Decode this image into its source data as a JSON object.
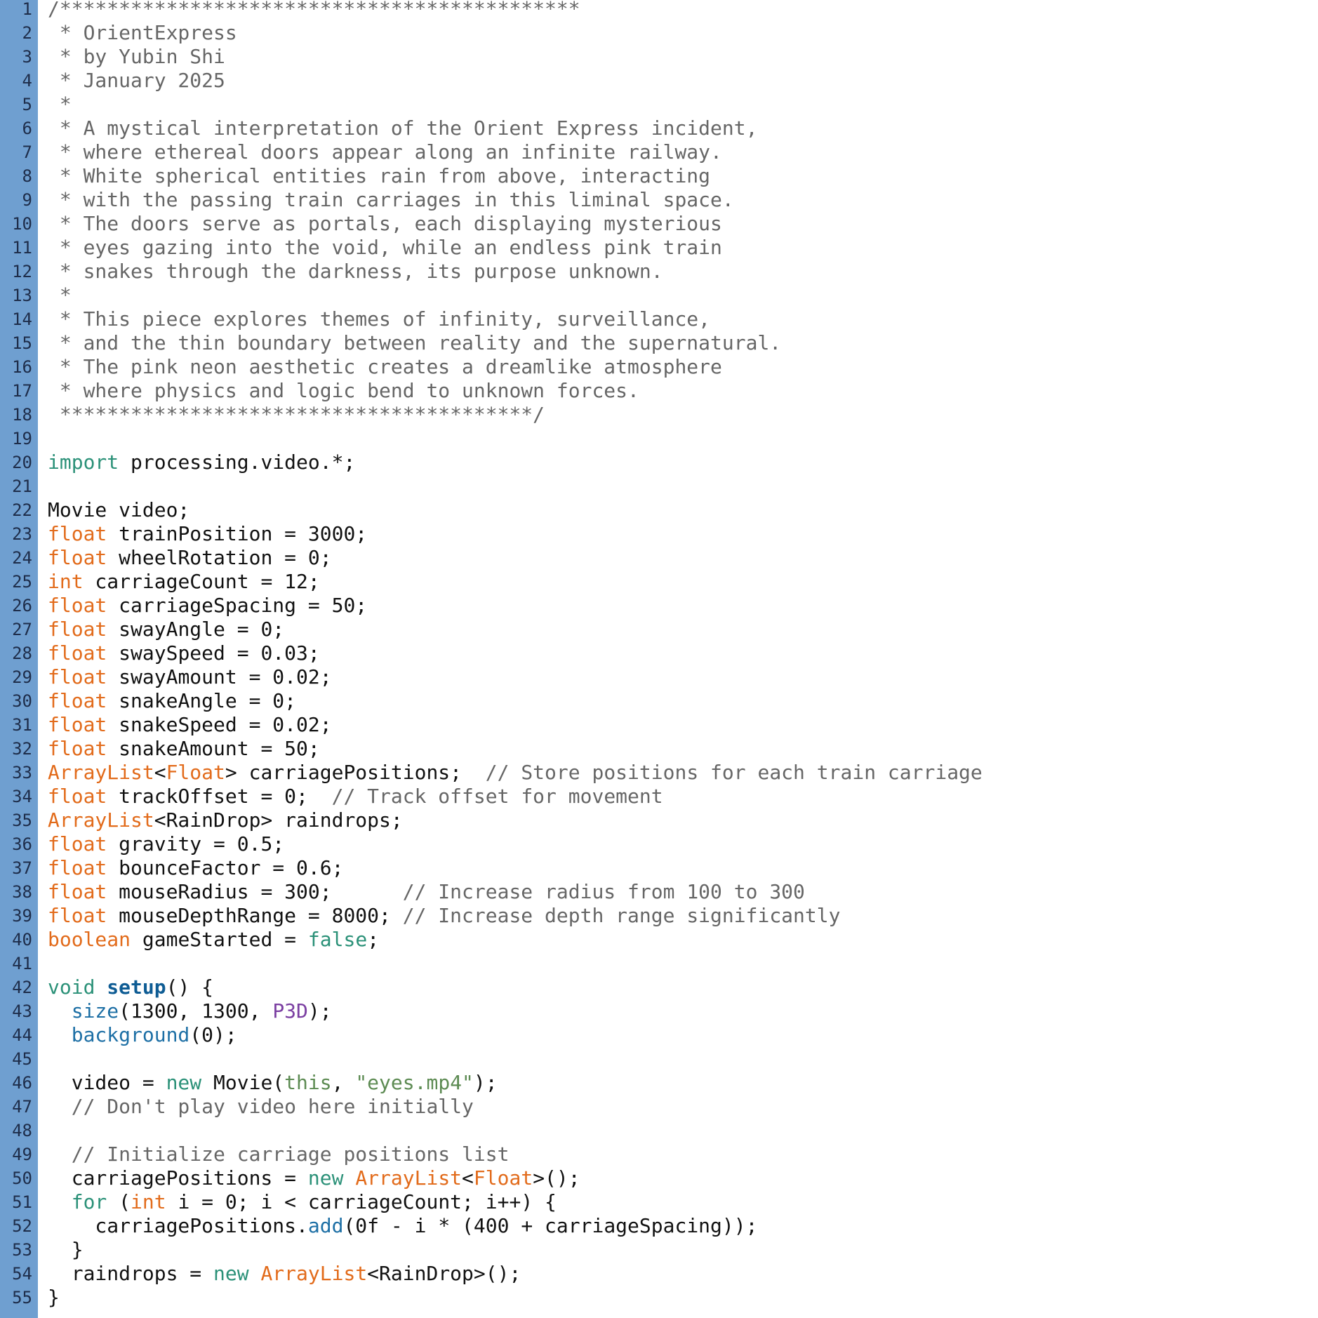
{
  "editor": {
    "colors": {
      "gutter": "#6f9fd0",
      "comment": "#666666",
      "keyword": "#2b9178",
      "type": "#e26b1b",
      "function": "#1d6fa5",
      "constant": "#7b3fa2",
      "string": "#5d8b53"
    },
    "lines": [
      {
        "n": "1",
        "tokens": [
          {
            "c": "comment",
            "t": "/********************************************"
          }
        ]
      },
      {
        "n": "2",
        "tokens": [
          {
            "c": "comment",
            "t": " * OrientExpress"
          }
        ]
      },
      {
        "n": "3",
        "tokens": [
          {
            "c": "comment",
            "t": " * by Yubin Shi"
          }
        ]
      },
      {
        "n": "4",
        "tokens": [
          {
            "c": "comment",
            "t": " * January 2025"
          }
        ]
      },
      {
        "n": "5",
        "tokens": [
          {
            "c": "comment",
            "t": " *"
          }
        ]
      },
      {
        "n": "6",
        "tokens": [
          {
            "c": "comment",
            "t": " * A mystical interpretation of the Orient Express incident,"
          }
        ]
      },
      {
        "n": "7",
        "tokens": [
          {
            "c": "comment",
            "t": " * where ethereal doors appear along an infinite railway."
          }
        ]
      },
      {
        "n": "8",
        "tokens": [
          {
            "c": "comment",
            "t": " * White spherical entities rain from above, interacting"
          }
        ]
      },
      {
        "n": "9",
        "tokens": [
          {
            "c": "comment",
            "t": " * with the passing train carriages in this liminal space."
          }
        ]
      },
      {
        "n": "10",
        "tokens": [
          {
            "c": "comment",
            "t": " * The doors serve as portals, each displaying mysterious"
          }
        ]
      },
      {
        "n": "11",
        "tokens": [
          {
            "c": "comment",
            "t": " * eyes gazing into the void, while an endless pink train"
          }
        ]
      },
      {
        "n": "12",
        "tokens": [
          {
            "c": "comment",
            "t": " * snakes through the darkness, its purpose unknown."
          }
        ]
      },
      {
        "n": "13",
        "tokens": [
          {
            "c": "comment",
            "t": " *"
          }
        ]
      },
      {
        "n": "14",
        "tokens": [
          {
            "c": "comment",
            "t": " * This piece explores themes of infinity, surveillance,"
          }
        ]
      },
      {
        "n": "15",
        "tokens": [
          {
            "c": "comment",
            "t": " * and the thin boundary between reality and the supernatural."
          }
        ]
      },
      {
        "n": "16",
        "tokens": [
          {
            "c": "comment",
            "t": " * The pink neon aesthetic creates a dreamlike atmosphere"
          }
        ]
      },
      {
        "n": "17",
        "tokens": [
          {
            "c": "comment",
            "t": " * where physics and logic bend to unknown forces."
          }
        ]
      },
      {
        "n": "18",
        "tokens": [
          {
            "c": "comment",
            "t": " ****************************************/"
          }
        ]
      },
      {
        "n": "19",
        "tokens": []
      },
      {
        "n": "20",
        "tokens": [
          {
            "c": "kw",
            "t": "import"
          },
          {
            "c": "plain",
            "t": " processing.video.*;"
          }
        ]
      },
      {
        "n": "21",
        "tokens": []
      },
      {
        "n": "22",
        "tokens": [
          {
            "c": "plain",
            "t": "Movie video;"
          }
        ]
      },
      {
        "n": "23",
        "tokens": [
          {
            "c": "type",
            "t": "float"
          },
          {
            "c": "plain",
            "t": " trainPosition = 3000;"
          }
        ]
      },
      {
        "n": "24",
        "tokens": [
          {
            "c": "type",
            "t": "float"
          },
          {
            "c": "plain",
            "t": " wheelRotation = 0;"
          }
        ]
      },
      {
        "n": "25",
        "tokens": [
          {
            "c": "type",
            "t": "int"
          },
          {
            "c": "plain",
            "t": " carriageCount = 12;"
          }
        ]
      },
      {
        "n": "26",
        "tokens": [
          {
            "c": "type",
            "t": "float"
          },
          {
            "c": "plain",
            "t": " carriageSpacing = 50;"
          }
        ]
      },
      {
        "n": "27",
        "tokens": [
          {
            "c": "type",
            "t": "float"
          },
          {
            "c": "plain",
            "t": " swayAngle = 0;"
          }
        ]
      },
      {
        "n": "28",
        "tokens": [
          {
            "c": "type",
            "t": "float"
          },
          {
            "c": "plain",
            "t": " swaySpeed = 0.03;"
          }
        ]
      },
      {
        "n": "29",
        "tokens": [
          {
            "c": "type",
            "t": "float"
          },
          {
            "c": "plain",
            "t": " swayAmount = 0.02;"
          }
        ]
      },
      {
        "n": "30",
        "tokens": [
          {
            "c": "type",
            "t": "float"
          },
          {
            "c": "plain",
            "t": " snakeAngle = 0;"
          }
        ]
      },
      {
        "n": "31",
        "tokens": [
          {
            "c": "type",
            "t": "float"
          },
          {
            "c": "plain",
            "t": " snakeSpeed = 0.02;"
          }
        ]
      },
      {
        "n": "32",
        "tokens": [
          {
            "c": "type",
            "t": "float"
          },
          {
            "c": "plain",
            "t": " snakeAmount = 50;"
          }
        ]
      },
      {
        "n": "33",
        "tokens": [
          {
            "c": "type",
            "t": "ArrayList"
          },
          {
            "c": "plain",
            "t": "<"
          },
          {
            "c": "type",
            "t": "Float"
          },
          {
            "c": "plain",
            "t": "> carriagePositions;  "
          },
          {
            "c": "comment",
            "t": "// Store positions for each train carriage"
          }
        ]
      },
      {
        "n": "34",
        "tokens": [
          {
            "c": "type",
            "t": "float"
          },
          {
            "c": "plain",
            "t": " trackOffset = 0;  "
          },
          {
            "c": "comment",
            "t": "// Track offset for movement"
          }
        ]
      },
      {
        "n": "35",
        "tokens": [
          {
            "c": "type",
            "t": "ArrayList"
          },
          {
            "c": "plain",
            "t": "<RainDrop> raindrops;"
          }
        ]
      },
      {
        "n": "36",
        "tokens": [
          {
            "c": "type",
            "t": "float"
          },
          {
            "c": "plain",
            "t": " gravity = 0.5;"
          }
        ]
      },
      {
        "n": "37",
        "tokens": [
          {
            "c": "type",
            "t": "float"
          },
          {
            "c": "plain",
            "t": " bounceFactor = 0.6;"
          }
        ]
      },
      {
        "n": "38",
        "tokens": [
          {
            "c": "type",
            "t": "float"
          },
          {
            "c": "plain",
            "t": " mouseRadius = 300;      "
          },
          {
            "c": "comment",
            "t": "// Increase radius from 100 to 300"
          }
        ]
      },
      {
        "n": "39",
        "tokens": [
          {
            "c": "type",
            "t": "float"
          },
          {
            "c": "plain",
            "t": " mouseDepthRange = 8000; "
          },
          {
            "c": "comment",
            "t": "// Increase depth range significantly"
          }
        ]
      },
      {
        "n": "40",
        "tokens": [
          {
            "c": "type",
            "t": "boolean"
          },
          {
            "c": "plain",
            "t": " gameStarted = "
          },
          {
            "c": "bool",
            "t": "false"
          },
          {
            "c": "plain",
            "t": ";"
          }
        ]
      },
      {
        "n": "41",
        "tokens": []
      },
      {
        "n": "42",
        "tokens": [
          {
            "c": "kw",
            "t": "void"
          },
          {
            "c": "plain",
            "t": " "
          },
          {
            "c": "funcdef",
            "t": "setup"
          },
          {
            "c": "plain",
            "t": "() {"
          }
        ]
      },
      {
        "n": "43",
        "tokens": [
          {
            "c": "plain",
            "t": "  "
          },
          {
            "c": "func",
            "t": "size"
          },
          {
            "c": "plain",
            "t": "(1300, 1300, "
          },
          {
            "c": "const",
            "t": "P3D"
          },
          {
            "c": "plain",
            "t": ");"
          }
        ]
      },
      {
        "n": "44",
        "tokens": [
          {
            "c": "plain",
            "t": "  "
          },
          {
            "c": "func",
            "t": "background"
          },
          {
            "c": "plain",
            "t": "(0);"
          }
        ]
      },
      {
        "n": "45",
        "tokens": []
      },
      {
        "n": "46",
        "tokens": [
          {
            "c": "plain",
            "t": "  video = "
          },
          {
            "c": "kw",
            "t": "new"
          },
          {
            "c": "plain",
            "t": " Movie("
          },
          {
            "c": "this",
            "t": "this"
          },
          {
            "c": "plain",
            "t": ", "
          },
          {
            "c": "str",
            "t": "\"eyes.mp4\""
          },
          {
            "c": "plain",
            "t": ");"
          }
        ]
      },
      {
        "n": "47",
        "tokens": [
          {
            "c": "plain",
            "t": "  "
          },
          {
            "c": "comment",
            "t": "// Don't play video here initially"
          }
        ]
      },
      {
        "n": "48",
        "tokens": []
      },
      {
        "n": "49",
        "tokens": [
          {
            "c": "plain",
            "t": "  "
          },
          {
            "c": "comment",
            "t": "// Initialize carriage positions list"
          }
        ]
      },
      {
        "n": "50",
        "tokens": [
          {
            "c": "plain",
            "t": "  carriagePositions = "
          },
          {
            "c": "kw",
            "t": "new"
          },
          {
            "c": "plain",
            "t": " "
          },
          {
            "c": "type",
            "t": "ArrayList"
          },
          {
            "c": "plain",
            "t": "<"
          },
          {
            "c": "type",
            "t": "Float"
          },
          {
            "c": "plain",
            "t": ">();"
          }
        ]
      },
      {
        "n": "51",
        "tokens": [
          {
            "c": "plain",
            "t": "  "
          },
          {
            "c": "kw",
            "t": "for"
          },
          {
            "c": "plain",
            "t": " ("
          },
          {
            "c": "type",
            "t": "int"
          },
          {
            "c": "plain",
            "t": " i = 0; i < carriageCount; i++) {"
          }
        ]
      },
      {
        "n": "52",
        "tokens": [
          {
            "c": "plain",
            "t": "    carriagePositions."
          },
          {
            "c": "func",
            "t": "add"
          },
          {
            "c": "plain",
            "t": "(0f - i * (400 + carriageSpacing));"
          }
        ]
      },
      {
        "n": "53",
        "tokens": [
          {
            "c": "plain",
            "t": "  }"
          }
        ]
      },
      {
        "n": "54",
        "tokens": [
          {
            "c": "plain",
            "t": "  raindrops = "
          },
          {
            "c": "kw",
            "t": "new"
          },
          {
            "c": "plain",
            "t": " "
          },
          {
            "c": "type",
            "t": "ArrayList"
          },
          {
            "c": "plain",
            "t": "<RainDrop>();"
          }
        ]
      },
      {
        "n": "55",
        "tokens": [
          {
            "c": "plain",
            "t": "}"
          }
        ]
      }
    ]
  }
}
